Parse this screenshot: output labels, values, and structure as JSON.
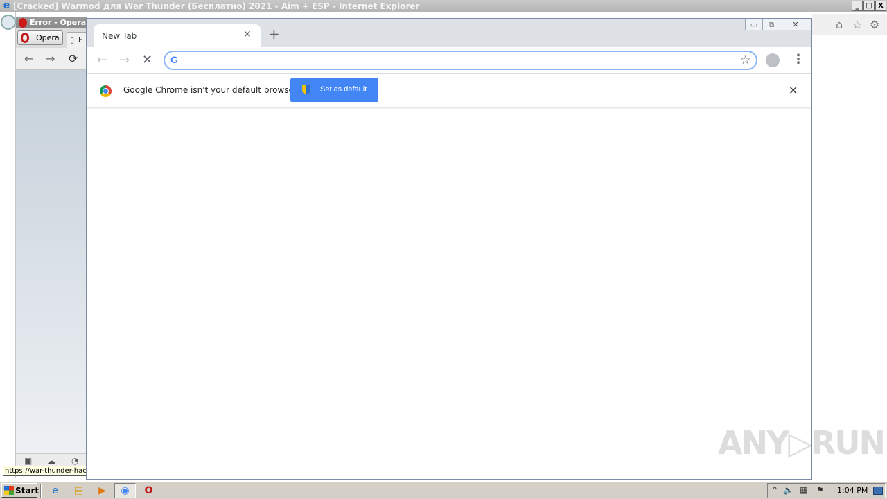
{
  "ie": {
    "title": "[Cracked] Warmod для War Thunder (Бесплатно) 2021 - Aim + ESP - Internet Explorer",
    "controls": [
      "_",
      "□",
      "X"
    ]
  },
  "opera": {
    "title": "Error - Opera",
    "menu_label": "Opera",
    "tab2_label": "E",
    "status_url": "https://war-thunder-hac"
  },
  "chrome": {
    "tab_title": "New Tab",
    "omnibox_value": "",
    "infobar_message": "Google Chrome isn't your default browser",
    "set_default_label": "Set as default"
  },
  "watermark": "ANY▷RUN",
  "taskbar": {
    "start_label": "Start",
    "clock": "1:04 PM"
  },
  "colors": {
    "chrome_accent": "#4285f4",
    "taskbar_bg": "#d4d0c8"
  }
}
